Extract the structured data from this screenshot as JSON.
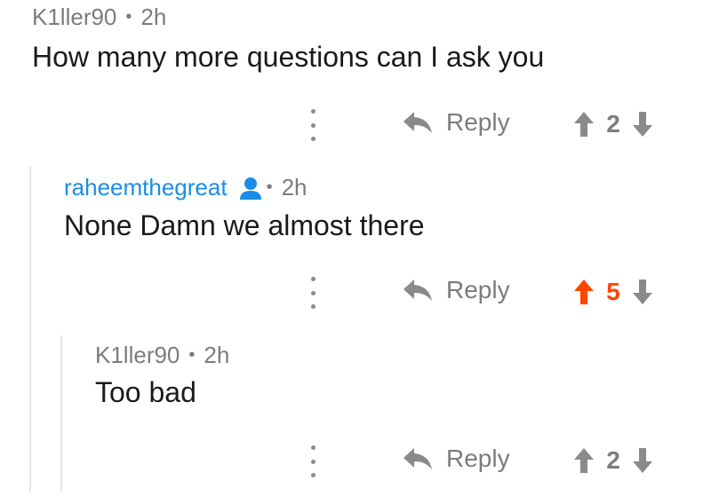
{
  "comments": [
    {
      "author": "K1ller90",
      "time": "2h",
      "body": "How many more questions can I ask you",
      "reply_label": "Reply",
      "score": "2",
      "vote_state": "none"
    },
    {
      "author": "raheemthegreat",
      "time": "2h",
      "body": "None Damn we almost there",
      "reply_label": "Reply",
      "score": "5",
      "vote_state": "upvoted",
      "author_is_op": true
    },
    {
      "author": "K1ller90",
      "time": "2h",
      "body": "Too bad",
      "reply_label": "Reply",
      "score": "2",
      "vote_state": "none"
    }
  ],
  "icons": {
    "reply": "reply-arrow-icon",
    "upvote": "upvote-arrow-icon",
    "downvote": "downvote-arrow-icon",
    "more": "more-vertical-icon",
    "op_badge": "user-icon"
  },
  "colors": {
    "upvoted": "#ff4500",
    "op_author": "#1a8ee6",
    "muted": "#7c7c7c",
    "text": "#1a1a1b"
  }
}
